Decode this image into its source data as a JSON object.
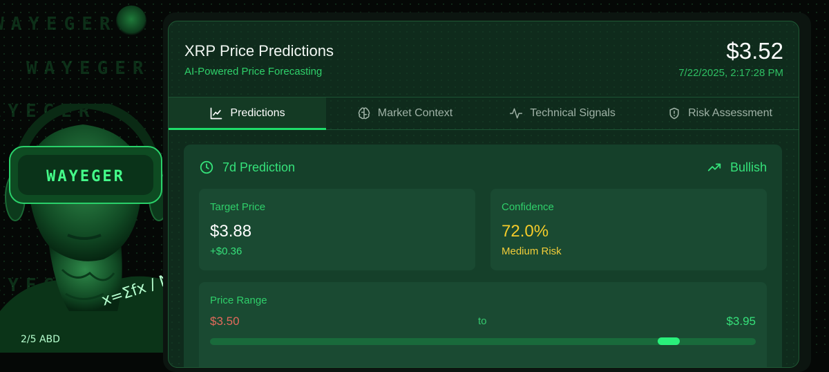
{
  "background": {
    "brand_text": "WAYEGER",
    "headset_text": "WAYEGER",
    "math_text": "x=Σfx / N",
    "math_text2": "2/5 ABD"
  },
  "header": {
    "title": "XRP Price Predictions",
    "subtitle": "AI-Powered Price Forecasting",
    "current_price": "$3.52",
    "timestamp": "7/22/2025, 2:17:28 PM"
  },
  "tabs": [
    {
      "label": "Predictions",
      "icon": "line-chart-icon",
      "active": true
    },
    {
      "label": "Market Context",
      "icon": "brain-icon",
      "active": false
    },
    {
      "label": "Technical Signals",
      "icon": "activity-pulse-icon",
      "active": false
    },
    {
      "label": "Risk Assessment",
      "icon": "shield-icon",
      "active": false
    }
  ],
  "prediction": {
    "horizon_label": "7d Prediction",
    "trend_label": "Bullish",
    "target": {
      "label": "Target Price",
      "value": "$3.88",
      "change": "+$0.36"
    },
    "confidence": {
      "label": "Confidence",
      "value": "72.0%",
      "risk": "Medium Risk"
    },
    "range": {
      "label": "Price Range",
      "low": "$3.50",
      "to_label": "to",
      "high": "$3.95",
      "marker_fraction": 0.84
    }
  },
  "colors": {
    "accent": "#1fdc6a",
    "panel_bg": "#0f2b1c",
    "card_bg": "#15402a",
    "stat_bg": "#1a4a32",
    "warning": "#f5cc2a",
    "negative": "#e46a5c"
  }
}
